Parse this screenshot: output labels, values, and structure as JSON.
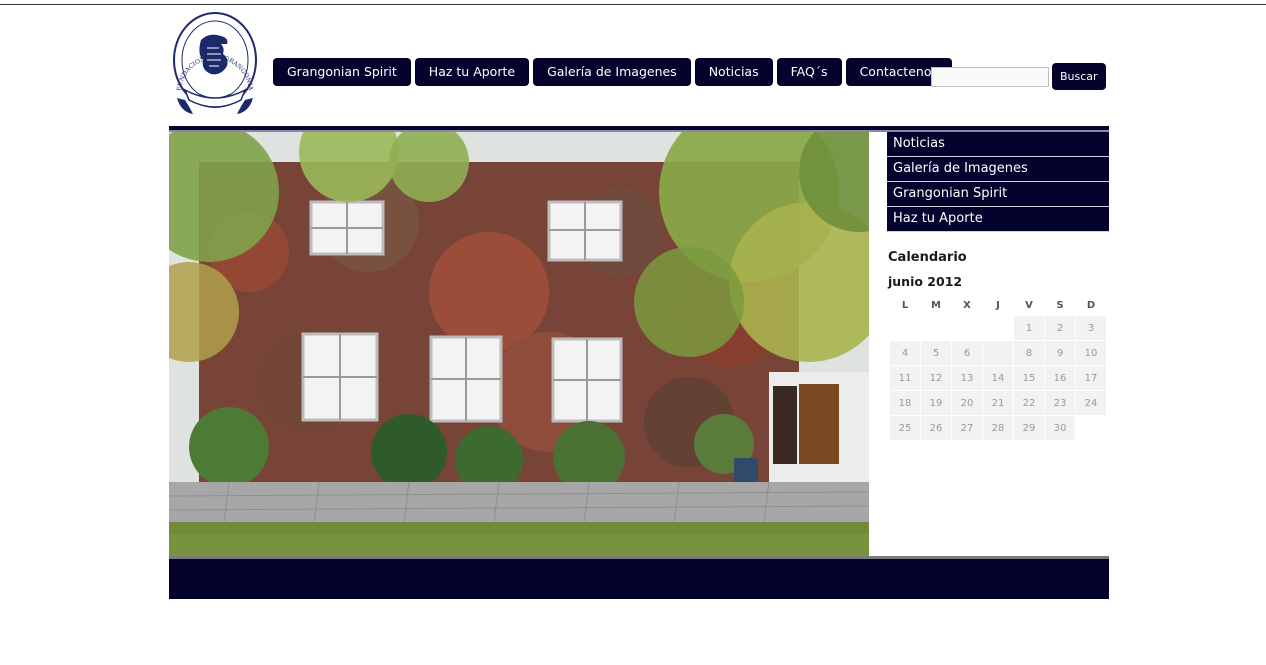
{
  "logo": {
    "ring_text": "FUNDACION OLD GRANGONIAN SOCIAL SERVICE"
  },
  "nav": {
    "items": [
      {
        "label": "Grangonian Spirit"
      },
      {
        "label": "Haz tu Aporte"
      },
      {
        "label": "Galería de Imagenes"
      },
      {
        "label": "Noticias"
      },
      {
        "label": "FAQ´s"
      },
      {
        "label": "Contactenos"
      }
    ]
  },
  "search": {
    "value": "",
    "button_label": "Buscar"
  },
  "sidebar": {
    "items": [
      {
        "label": "Noticias"
      },
      {
        "label": "Galería de Imagenes"
      },
      {
        "label": "Grangonian Spirit"
      },
      {
        "label": "Haz tu Aporte"
      }
    ]
  },
  "calendar": {
    "title": "Calendario",
    "month": "junio 2012",
    "weekdays": [
      "L",
      "M",
      "X",
      "J",
      "V",
      "S",
      "D"
    ],
    "weeks": [
      [
        "",
        "",
        "",
        "",
        "1",
        "2",
        "3"
      ],
      [
        "4",
        "5",
        "6",
        "7",
        "8",
        "9",
        "10"
      ],
      [
        "11",
        "12",
        "13",
        "14",
        "15",
        "16",
        "17"
      ],
      [
        "18",
        "19",
        "20",
        "21",
        "22",
        "23",
        "24"
      ],
      [
        "25",
        "26",
        "27",
        "28",
        "29",
        "30",
        ""
      ]
    ]
  },
  "colors": {
    "brand_navy": "#03032e",
    "page_bg": "#ffffff"
  }
}
